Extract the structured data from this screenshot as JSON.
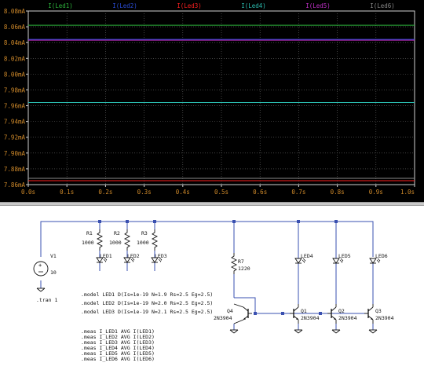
{
  "chart_data": {
    "type": "line",
    "x_unit": "s",
    "xlim": [
      0,
      1.0
    ],
    "ylim": [
      7.86,
      8.08
    ],
    "y_unit": "mA",
    "x_ticks": [
      "0.0s",
      "0.1s",
      "0.2s",
      "0.3s",
      "0.4s",
      "0.5s",
      "0.6s",
      "0.7s",
      "0.8s",
      "0.9s",
      "1.0s"
    ],
    "y_ticks": [
      "8.08mA",
      "8.06mA",
      "8.04mA",
      "8.02mA",
      "8.00mA",
      "7.98mA",
      "7.96mA",
      "7.94mA",
      "7.92mA",
      "7.90mA",
      "7.88mA",
      "7.86mA"
    ],
    "background": "#000000",
    "grid": "dotted",
    "series": [
      {
        "name": "I(Led1)",
        "color": "#2db43c",
        "x": [
          0,
          1.0
        ],
        "y": [
          8.062,
          8.062
        ]
      },
      {
        "name": "I(Led2)",
        "color": "#2a4cd6",
        "x": [
          0,
          1.0
        ],
        "y": [
          8.044,
          8.044
        ]
      },
      {
        "name": "I(Led3)",
        "color": "#ff2020",
        "x": [
          0,
          1.0
        ],
        "y": [
          7.865,
          7.865
        ]
      },
      {
        "name": "I(Led4)",
        "color": "#2bbdb0",
        "x": [
          0,
          1.0
        ],
        "y": [
          7.964,
          7.964
        ]
      },
      {
        "name": "I(Led5)",
        "color": "#c030c8",
        "x": [
          0,
          1.0
        ],
        "y": [
          8.043,
          8.043
        ]
      },
      {
        "name": "I(Led6)",
        "color": "#888888",
        "x": [
          0,
          1.0
        ],
        "y": [
          7.868,
          7.868
        ]
      }
    ]
  },
  "schematic": {
    "source": {
      "name": "V1",
      "value": "10"
    },
    "resistors": [
      {
        "name": "R1",
        "value": "1000"
      },
      {
        "name": "R2",
        "value": "1000"
      },
      {
        "name": "R3",
        "value": "1000"
      },
      {
        "name": "R7",
        "value": "1220"
      }
    ],
    "leds": [
      "LED1",
      "LED2",
      "LED3",
      "LED4",
      "LED5",
      "LED6"
    ],
    "transistors": [
      {
        "name": "Q4",
        "model": "2N3904"
      },
      {
        "name": "Q1",
        "model": "2N3904"
      },
      {
        "name": "Q2",
        "model": "2N3904"
      },
      {
        "name": "Q3",
        "model": "2N3904"
      }
    ],
    "directive_tran": ".tran 1",
    "models": [
      ".model LED1 D(Is=1e-19 N=1.9 Rs=2.5 Eg=2.5)",
      ".model LED2 D(Is=1e-19 N=2.0 Rs=2.5 Eg=2.5)",
      ".model LED3 D(Is=1e-19 N=2.1 Rs=2.5 Eg=2.5)"
    ],
    "meas": [
      ".meas I_LED1 AVG I(LED1)",
      ".meas I_LED2 AVG I(LED2)",
      ".meas I_LED3 AVG I(LED3)",
      ".meas I_LED4 AVG I(LED4)",
      ".meas I_LED5 AVG I(LED5)",
      ".meas I_LED6 AVG I(LED6)"
    ],
    "colors": {
      "wire": "#3a50b0",
      "component": "#111111",
      "junction": "#3a50b0"
    }
  }
}
